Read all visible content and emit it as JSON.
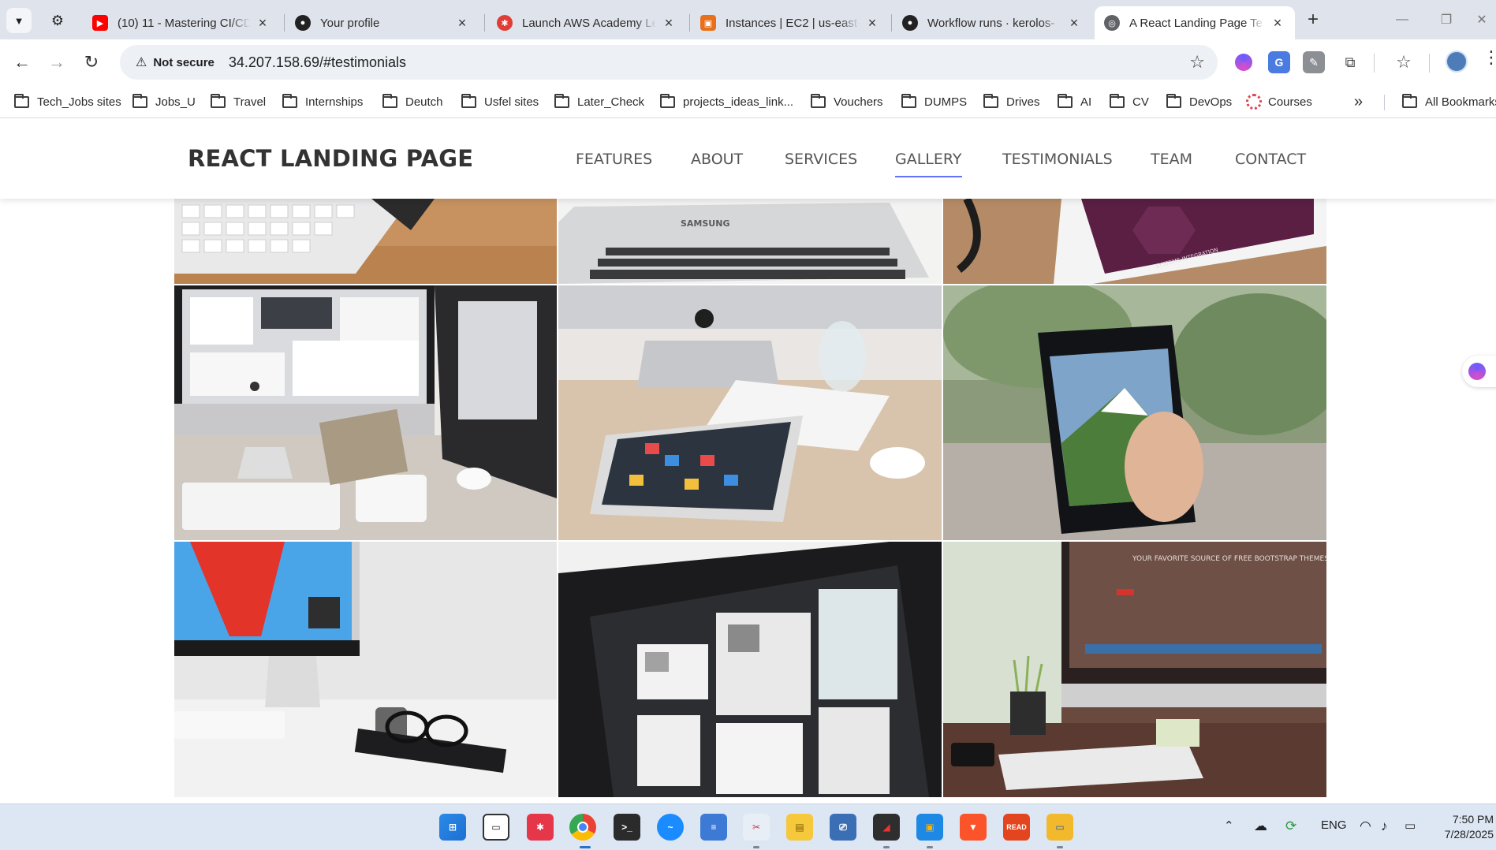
{
  "browser": {
    "tabs": [
      {
        "title": "(10) 11 - Mastering CI/CD",
        "favicon": "youtube-icon",
        "color": "#ff0000"
      },
      {
        "title": "Your profile",
        "favicon": "github-icon",
        "color": "#222222"
      },
      {
        "title": "Launch AWS Academy Le",
        "favicon": "canvas-icon",
        "color": "#e13c35"
      },
      {
        "title": "Instances | EC2 | us-east-",
        "favicon": "aws-icon",
        "color": "#e8701a"
      },
      {
        "title": "Workflow runs · kerolos-",
        "favicon": "github-icon",
        "color": "#222222"
      },
      {
        "title": "A React Landing Page Te",
        "favicon": "globe-icon",
        "color": "#5f6368"
      }
    ],
    "security_label": "Not secure",
    "url": "34.207.158.69/#testimonials",
    "bookmarks": [
      "Tech_Jobs sites",
      "Jobs_U",
      "Travel",
      "Internships",
      "Deutch",
      "Usfel sites",
      "Later_Check",
      "projects_ideas_link...",
      "Vouchers",
      "DUMPS",
      "Drives",
      "AI",
      "CV",
      "DevOps",
      "Courses"
    ],
    "all_bookmarks": "All Bookmarks"
  },
  "site": {
    "brand": "REACT LANDING PAGE",
    "nav": [
      "FEATURES",
      "ABOUT",
      "SERVICES",
      "GALLERY",
      "TESTIMONIALS",
      "TEAM",
      "CONTACT"
    ],
    "active_nav": "GALLERY",
    "accent": "#6372ff",
    "gallery": [
      {
        "subject": "keyboard-on-wooden-desk",
        "samsung_label": ""
      },
      {
        "subject": "samsung-laptop",
        "samsung_label": "SAMSUNG"
      },
      {
        "subject": "tablet-systems-integration",
        "samsung_label": "SYSTEMS INTEGRATION"
      },
      {
        "subject": "imac-dual-monitor-workspace"
      },
      {
        "subject": "imac-with-ipad-and-glass"
      },
      {
        "subject": "hand-holding-android-phone"
      },
      {
        "subject": "imac-golden-gate-wallpaper-glasses"
      },
      {
        "subject": "monitor-with-web-gallery"
      },
      {
        "subject": "imac-with-bootstrap-themes-site",
        "screen_text": "YOUR FAVORITE SOURCE OF FREE BOOTSTRAP THEMES"
      }
    ]
  },
  "taskbar": {
    "language": "ENG",
    "time": "7:50 PM",
    "date": "7/28/2025"
  }
}
